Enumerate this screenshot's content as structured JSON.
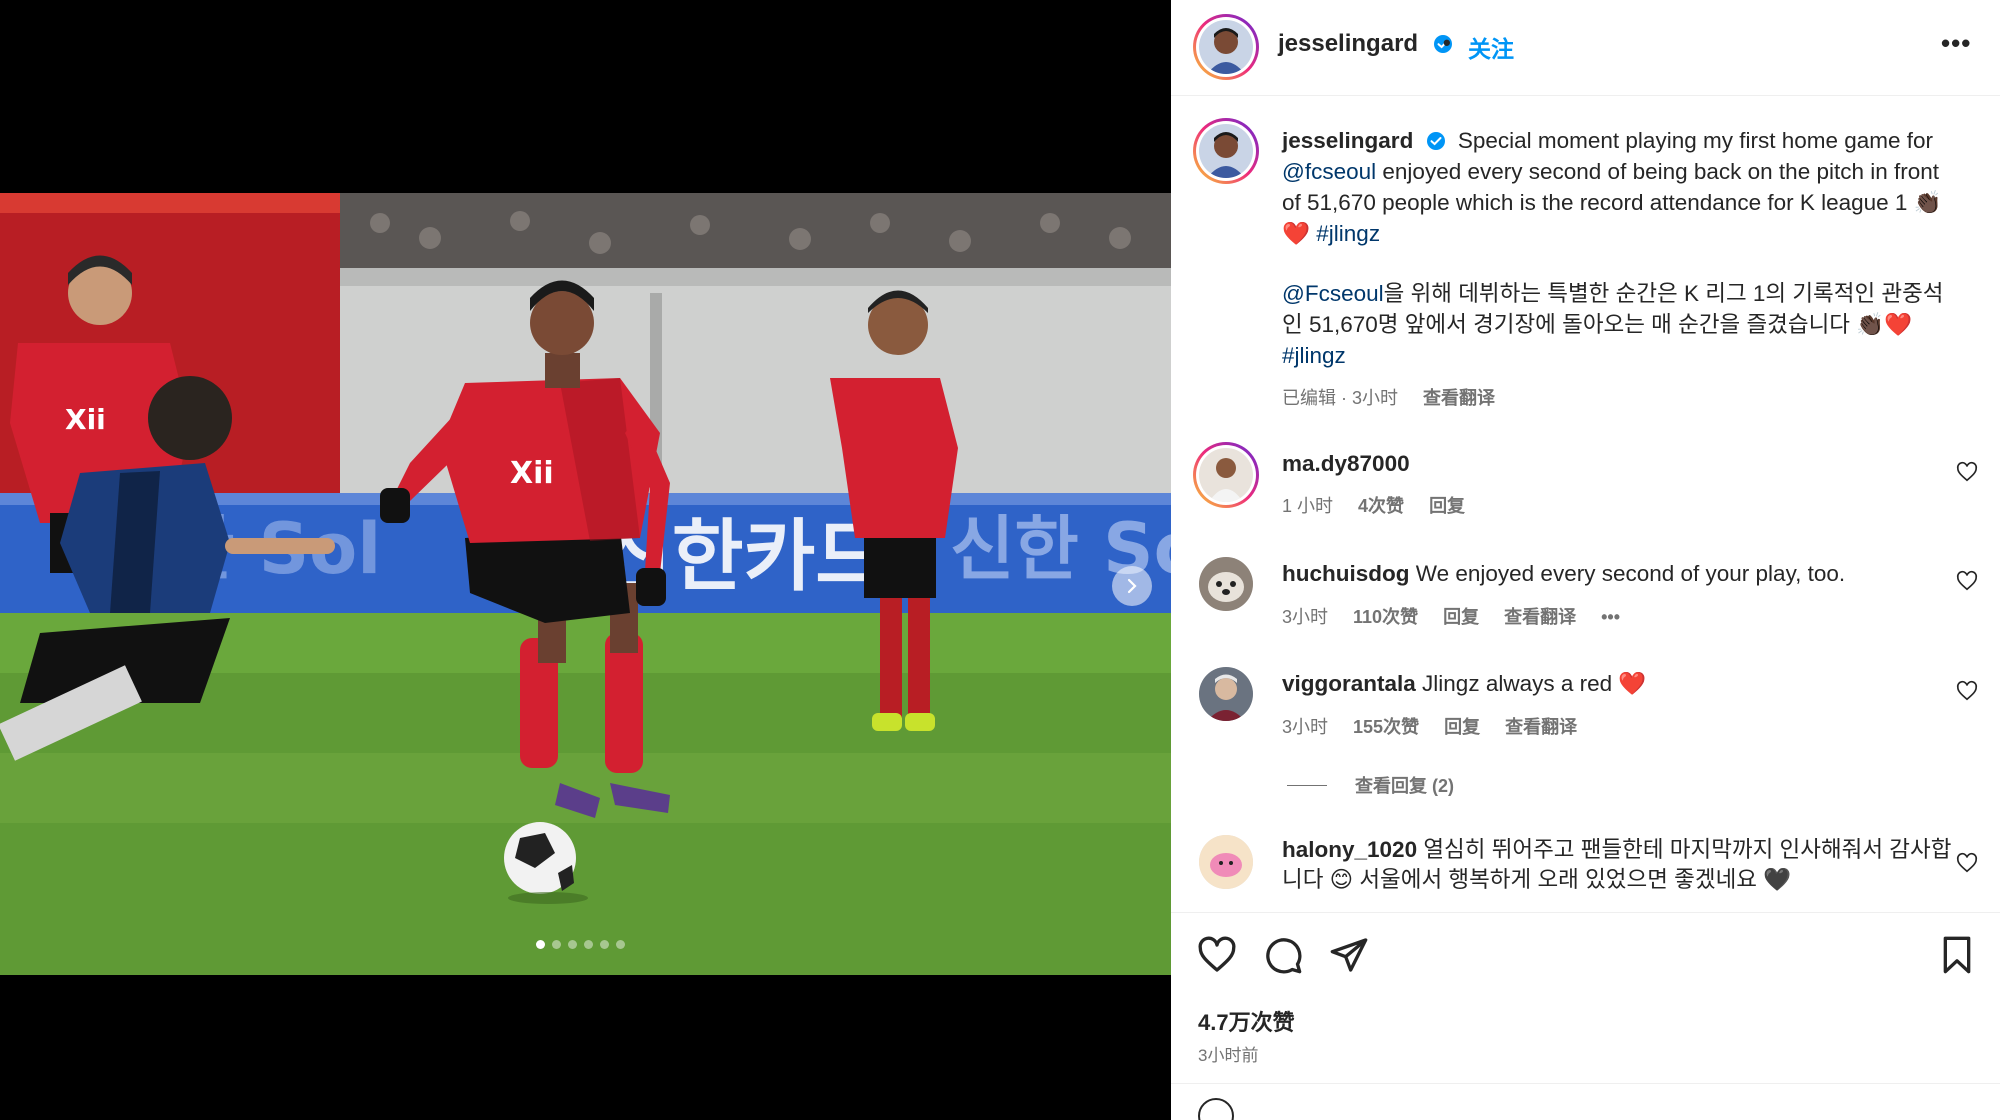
{
  "post": {
    "username": "jesselingard",
    "follow_separator": "•",
    "follow_label": "关注",
    "more_label": "•••"
  },
  "caption": {
    "username": "jesselingard",
    "text_1": "Special moment playing my first home game for",
    "mention_1": "@fcseoul",
    "text_2": "enjoyed every second of being back on the pitch in front of 51,670 people which is the record attendance for K league 1",
    "emoji_1": "👏🏿❤️",
    "hashtag_1": "#jlingz",
    "ko_mention": "@Fcseoul",
    "ko_text": "을 위해 데뷔하는 특별한 순간은 K 리그 1의 기록적인 관중석인 51,670명 앞에서 경기장에 돌아오는 매 순간을 즐겼습니다",
    "ko_emoji": "👏🏿❤️",
    "ko_hashtag": "#jlingz",
    "meta_edited": "已编辑 · 3小时",
    "see_translation": "查看翻译"
  },
  "comments": [
    {
      "username": "ma.dy87000",
      "text": "",
      "time": "1 小时",
      "likes": "4次赞",
      "reply": "回复",
      "translate": ""
    },
    {
      "username": "huchuisdog",
      "text": "We enjoyed every second of your play, too.",
      "time": "3小时",
      "likes": "110次赞",
      "reply": "回复",
      "translate": "查看翻译",
      "more": "•••"
    },
    {
      "username": "viggorantala",
      "text": "Jlingz always a red ❤️",
      "time": "3小时",
      "likes": "155次赞",
      "reply": "回复",
      "translate": "查看翻译"
    },
    {
      "username": "halony_1020",
      "text": "열심히 뛰어주고 팬들한테 마지막까지 인사해줘서 감사합니다 😊 서울에서 행복하게 오래 있었으면 좋겠네요 🖤",
      "time": "",
      "likes": "",
      "reply": "",
      "translate": ""
    }
  ],
  "view_replies": "查看回复 (2)",
  "footer": {
    "likes": "4.7万次赞",
    "posted_time": "3小时前"
  },
  "photo": {
    "banner_text": "신한카드",
    "sponsor": "Xii"
  },
  "colors": {
    "link": "#00376b",
    "follow": "#0095f6",
    "jersey_red": "#d32030",
    "opponent_blue": "#1b3c7a"
  }
}
